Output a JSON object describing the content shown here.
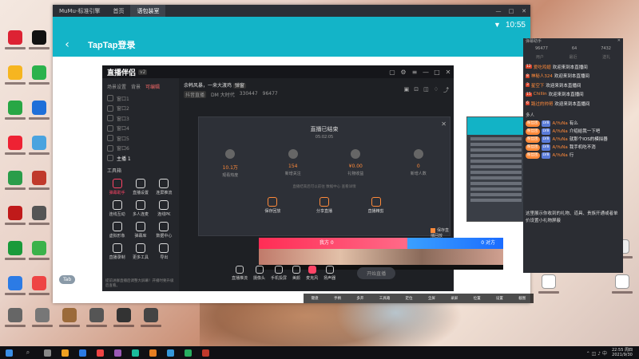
{
  "emulator": {
    "app_name": "MuMu-标准引擎",
    "tabs": [
      "首页",
      "语包装室"
    ],
    "window_buttons": [
      "—",
      "□",
      "✕"
    ],
    "time": "10:55",
    "page_title": "TapTap登录",
    "tab_pill": "Tab",
    "bottom_tools": [
      "键盘",
      "手柄",
      "多开",
      "工具箱",
      "定位",
      "全屏",
      "录屏",
      "位置",
      "设置",
      "截图"
    ]
  },
  "streamer": {
    "logo": "直播伴侣",
    "version": "v2",
    "left_tabs": [
      "场景设置",
      "背景",
      "可编辑"
    ],
    "scenes": [
      "窗口1",
      "窗口2",
      "窗口3",
      "窗口4",
      "窗口5",
      "窗口6",
      "主播 1"
    ],
    "tools_header": "工具箱",
    "tools": [
      "弹幕助手",
      "直播设置",
      "连屏推流",
      "连线互动",
      "多人连麦",
      "连线PK",
      "虚拟形象",
      "弹幕库",
      "数据中心",
      "直播录制",
      "更多工具",
      "导出"
    ],
    "room_line1": "余韩风暴，一来大渡鸡",
    "room_tag": "弹窗",
    "room_line2_a": "抖音直播",
    "room_line2_b": "DM 大时代",
    "room_line2_c": "330447",
    "room_line2_d": "96477",
    "notice": "提前进群直播后调整大屏幕！开播时要升级后查看。",
    "end_card": {
      "title": "直播已结束",
      "time": "05:02:05",
      "stats": [
        {
          "value": "10.1万",
          "label": "观看热度"
        },
        {
          "value": "154",
          "label": "新增关注"
        },
        {
          "value": "¥0.00",
          "label": "礼物收益"
        },
        {
          "value": "0",
          "label": "新增人数"
        }
      ],
      "note": "直播结束后可以前往 数据中心 查看详情",
      "actions": [
        "保存回放",
        "分享直播",
        "直播精剪"
      ],
      "checkbox": "保存直播回放"
    },
    "pk_left": "我方 0",
    "pk_right": "0 对方",
    "controls": [
      "直播推流",
      "摄像头",
      "手机投屏",
      "美颜",
      "麦克风",
      "扬声器"
    ],
    "start_button": "开始直播"
  },
  "chat": {
    "title": "弹幕助手",
    "stats": [
      "96477",
      "64",
      "7432"
    ],
    "headers": [
      "用户",
      "最近",
      "送礼"
    ],
    "welcome": [
      {
        "level": "12",
        "name": "爱吃鸡翅",
        "text": "欢迎来到本直播间"
      },
      {
        "level": "8",
        "name": "神秘人324",
        "text": "欢迎来到本直播间"
      },
      {
        "level": "3",
        "name": "星空下",
        "text": "欢迎来到本直播间"
      },
      {
        "level": "15",
        "name": "Chillin",
        "text": "欢迎来到本直播间"
      },
      {
        "level": "6",
        "name": "路过的帅哥",
        "text": "欢迎来到本直播间"
      }
    ],
    "section": "多人",
    "gifts": [
      {
        "b1": "粉丝团",
        "b2": "LV8",
        "user": "A/YuNa",
        "text": "有么"
      },
      {
        "b1": "粉丝团",
        "b2": "LV8",
        "user": "A/YuNa",
        "text": "介绍给我一下吧"
      },
      {
        "b1": "粉丝团",
        "b2": "LV8",
        "user": "A/YuNa",
        "text": "就那个IOS的模拟器"
      },
      {
        "b1": "粉丝团",
        "b2": "LV8",
        "user": "A/YuNa",
        "text": "我手机吃不消"
      },
      {
        "b1": "粉丝团",
        "b2": "LV8",
        "user": "A/YuNa",
        "text": "行"
      }
    ],
    "footer": "这里展示你收到的礼物、道具、贵族开通或者单价设置小礼物屏蔽"
  },
  "taskbar": {
    "time": "22:55 周四",
    "date": "2021/9/30"
  }
}
